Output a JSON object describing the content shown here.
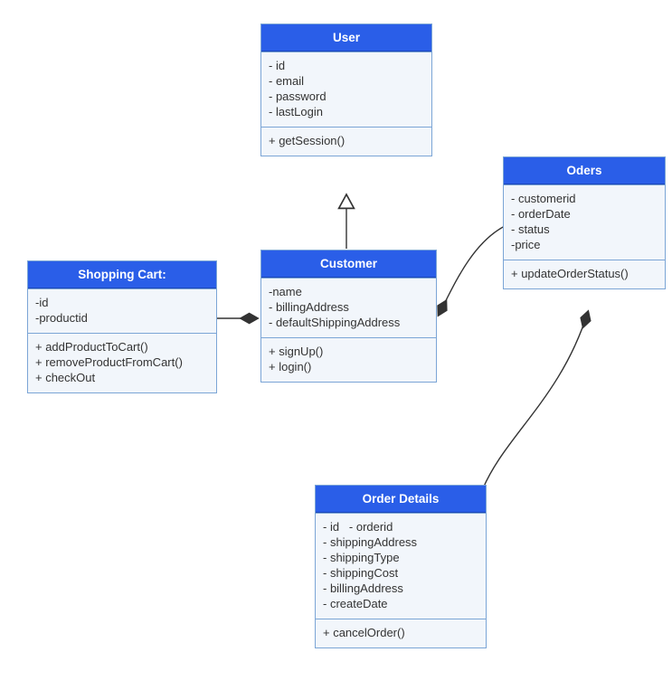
{
  "classes": {
    "user": {
      "title": "User",
      "attributes": [
        "- id",
        "- email",
        "- password",
        "- lastLogin"
      ],
      "methods": [
        "+ getSession()"
      ]
    },
    "shoppingCart": {
      "title": "Shopping Cart:",
      "attributes": [
        "-id",
        "-productid"
      ],
      "methods": [
        "+ addProductToCart()",
        "+ removeProductFromCart()",
        "+ checkOut"
      ]
    },
    "customer": {
      "title": "Customer",
      "attributes": [
        "-name",
        "- billingAddress",
        "- defaultShippingAddress"
      ],
      "methods": [
        "+ signUp()",
        "+ login()"
      ]
    },
    "orders": {
      "title": "Oders",
      "attributes": [
        "- customerid",
        "- orderDate",
        "- status",
        "-price"
      ],
      "methods": [
        "+ updateOrderStatus()"
      ]
    },
    "orderDetails": {
      "title": "Order Details",
      "attributes": [
        "- id   - orderid",
        "- shippingAddress",
        "- shippingType",
        "- shippingCost",
        "- billingAddress",
        "- createDate"
      ],
      "methods": [
        "+ cancelOrder()"
      ]
    }
  },
  "chart_data": {
    "type": "uml-class-diagram",
    "classes": [
      {
        "name": "User",
        "attributes": [
          "id",
          "email",
          "password",
          "lastLogin"
        ],
        "methods": [
          "getSession()"
        ]
      },
      {
        "name": "Shopping Cart:",
        "attributes": [
          "id",
          "productid"
        ],
        "methods": [
          "addProductToCart()",
          "removeProductFromCart()",
          "checkOut"
        ]
      },
      {
        "name": "Customer",
        "attributes": [
          "name",
          "billingAddress",
          "defaultShippingAddress"
        ],
        "methods": [
          "signUp()",
          "login()"
        ]
      },
      {
        "name": "Oders",
        "attributes": [
          "customerid",
          "orderDate",
          "status",
          "price"
        ],
        "methods": [
          "updateOrderStatus()"
        ]
      },
      {
        "name": "Order Details",
        "attributes": [
          "id",
          "orderid",
          "shippingAddress",
          "shippingType",
          "shippingCost",
          "billingAddress",
          "createDate"
        ],
        "methods": [
          "cancelOrder()"
        ]
      }
    ],
    "relationships": [
      {
        "from": "Customer",
        "to": "User",
        "type": "generalization"
      },
      {
        "from": "Shopping Cart:",
        "to": "Customer",
        "type": "composition",
        "owner": "Customer"
      },
      {
        "from": "Customer",
        "to": "Oders",
        "type": "composition",
        "owner": "Customer"
      },
      {
        "from": "Order Details",
        "to": "Oders",
        "type": "composition",
        "owner": "Oders"
      }
    ]
  }
}
